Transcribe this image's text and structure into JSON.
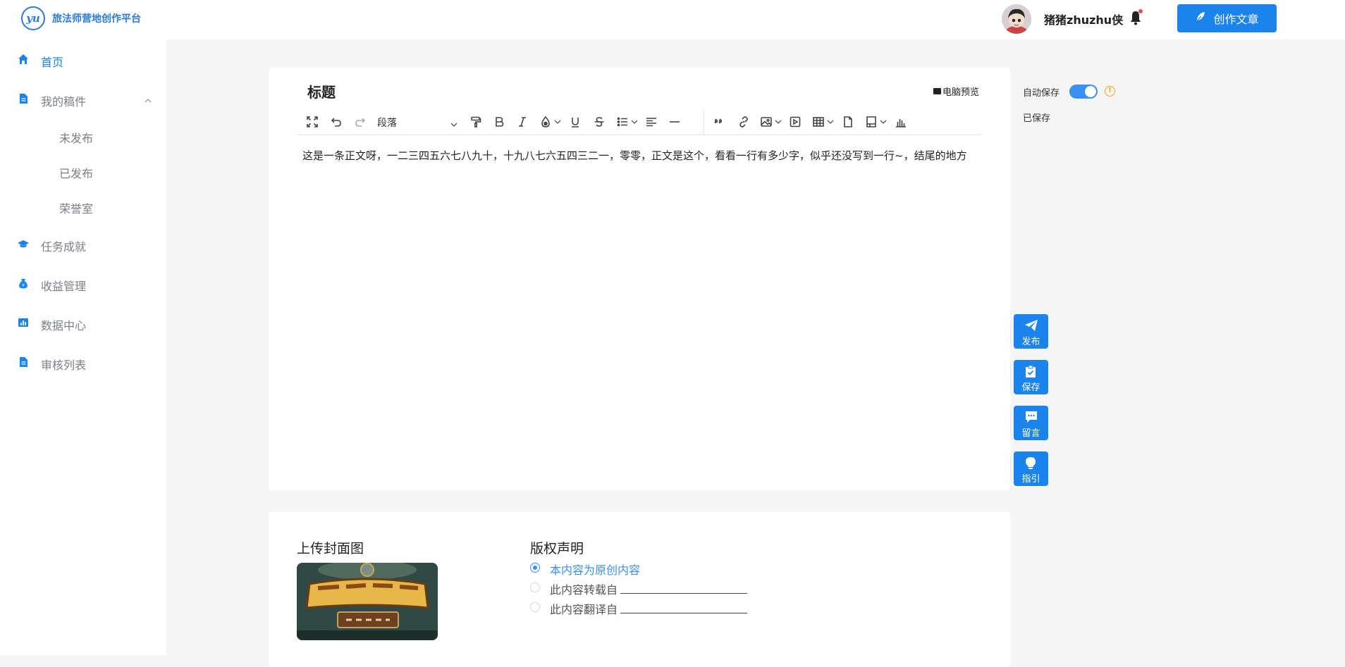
{
  "header": {
    "logo_text": "yu",
    "brand": "旅法师营地创作平台",
    "username": "猪猪zhuzhu侠",
    "create_button": "创作文章"
  },
  "sidebar": {
    "items": [
      {
        "label": "首页",
        "icon": "home-icon",
        "active": true
      },
      {
        "label": "我的稿件",
        "icon": "document-icon",
        "expanded": true
      },
      {
        "label": "任务成就",
        "icon": "graduation-cap-icon"
      },
      {
        "label": "收益管理",
        "icon": "money-bag-icon"
      },
      {
        "label": "数据中心",
        "icon": "chart-icon"
      },
      {
        "label": "审核列表",
        "icon": "list-document-icon"
      }
    ],
    "sub_items": [
      "未发布",
      "已发布",
      "荣誉室"
    ]
  },
  "editor": {
    "title_placeholder": "标题",
    "preview": "电脑预览",
    "paragraph_select": "段落",
    "body": "这是一条正文呀，一二三四五六七八九十，十九八七六五四三二一，零零，正文是这个，看看一行有多少字，似乎还没写到一行~，结尾的地方"
  },
  "right_panel": {
    "autosave_label": "自动保存",
    "autosave_on": true,
    "saved_status": "已保存",
    "buttons": [
      {
        "label": "发布",
        "icon": "paper-plane-icon"
      },
      {
        "label": "保存",
        "icon": "clipboard-check-icon"
      },
      {
        "label": "留言",
        "icon": "comment-icon"
      },
      {
        "label": "指引",
        "icon": "lightbulb-icon"
      }
    ]
  },
  "bottom": {
    "cover_title": "上传封面图",
    "copyright_title": "版权声明",
    "options": [
      {
        "label": "本内容为原创内容",
        "selected": true
      },
      {
        "label": "此内容转载自",
        "selected": false
      },
      {
        "label": "此内容翻译自",
        "selected": false
      }
    ]
  },
  "colors": {
    "accent": "#1a84ec",
    "nav_text": "#7a7f87",
    "warning": "#f0a020"
  }
}
